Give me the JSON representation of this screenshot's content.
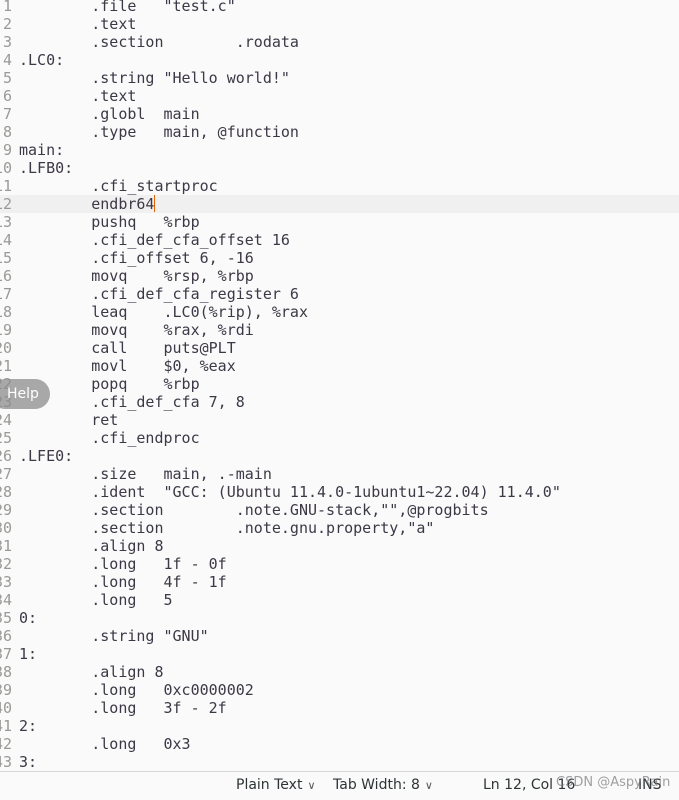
{
  "editor": {
    "current_line": 12,
    "lines": [
      "\t.file\t\"test.c\"",
      "\t.text",
      "\t.section\t.rodata",
      ".LC0:",
      "\t.string \"Hello world!\"",
      "\t.text",
      "\t.globl\tmain",
      "\t.type\tmain, @function",
      "main:",
      ".LFB0:",
      "\t.cfi_startproc",
      "\tendbr64",
      "\tpushq\t%rbp",
      "\t.cfi_def_cfa_offset 16",
      "\t.cfi_offset 6, -16",
      "\tmovq\t%rsp, %rbp",
      "\t.cfi_def_cfa_register 6",
      "\tleaq\t.LC0(%rip), %rax",
      "\tmovq\t%rax, %rdi",
      "\tcall\tputs@PLT",
      "\tmovl\t$0, %eax",
      "\tpopq\t%rbp",
      "\t.cfi_def_cfa 7, 8",
      "\tret",
      "\t.cfi_endproc",
      ".LFE0:",
      "\t.size\tmain, .-main",
      "\t.ident\t\"GCC: (Ubuntu 11.4.0-1ubuntu1~22.04) 11.4.0\"",
      "\t.section\t.note.GNU-stack,\"\",@progbits",
      "\t.section\t.note.gnu.property,\"a\"",
      "\t.align 8",
      "\t.long\t1f - 0f",
      "\t.long\t4f - 1f",
      "\t.long\t5",
      "0:",
      "\t.string \"GNU\"",
      "1:",
      "\t.align 8",
      "\t.long\t0xc0000002",
      "\t.long\t3f - 2f",
      "2:",
      "\t.long\t0x3",
      "3:"
    ]
  },
  "help_label": "Help",
  "status": {
    "language": "Plain Text",
    "tab_width": "Tab Width: 8",
    "position": "Ln 12, Col 16",
    "mode": "INS"
  },
  "watermark": "CSDN @AspyRain",
  "colors": {
    "caret": "#e66100",
    "text": "#3d3846",
    "line_numbers": "#9a9996"
  }
}
